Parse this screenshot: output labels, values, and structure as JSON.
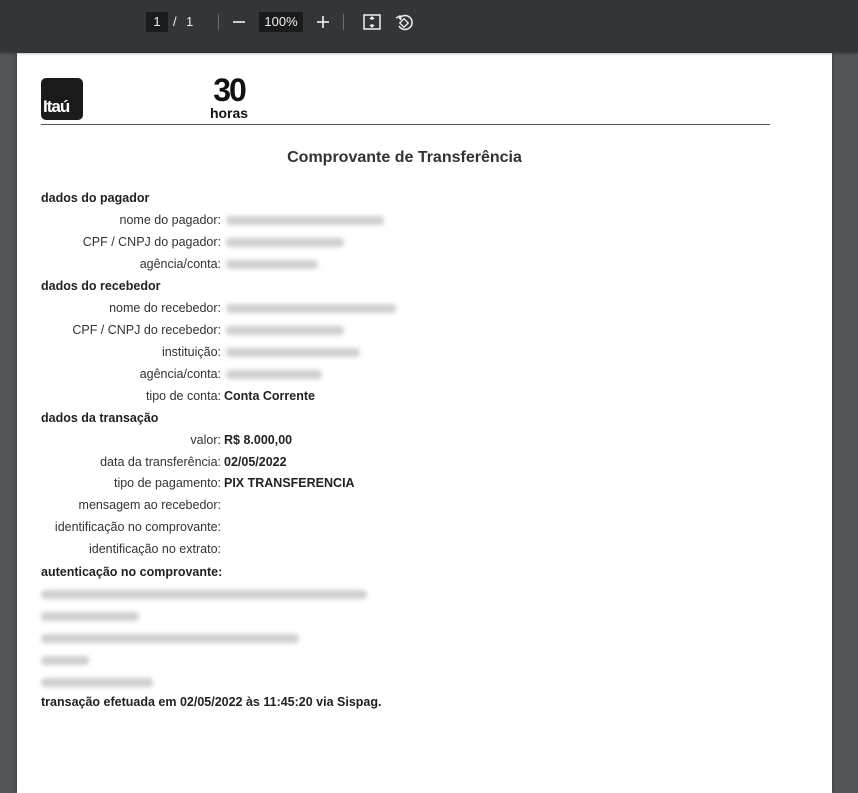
{
  "toolbar": {
    "current_page": "1",
    "page_separator": "/",
    "total_pages": "1",
    "zoom": "100%"
  },
  "header": {
    "bank_logo_text": "Itaú",
    "service_logo_number": "30",
    "service_logo_word": "horas"
  },
  "document": {
    "title": "Comprovante de Transferência",
    "payer": {
      "section": "dados do pagador",
      "name_label": "nome do pagador:",
      "cpf_label": "CPF / CNPJ do pagador:",
      "account_label": "agência/conta:"
    },
    "receiver": {
      "section": "dados do recebedor",
      "name_label": "nome do recebedor:",
      "cpf_label": "CPF / CNPJ do recebedor:",
      "institution_label": "instituição:",
      "account_label": "agência/conta:",
      "account_type_label": "tipo de conta:",
      "account_type_value": "Conta Corrente"
    },
    "transaction": {
      "section": "dados da transação",
      "value_label": "valor:",
      "value": "R$ 8.000,00",
      "date_label": "data da transferência:",
      "date": "02/05/2022",
      "payment_type_label": "tipo de pagamento:",
      "payment_type": "PIX TRANSFERENCIA",
      "message_label": "mensagem ao recebedor:",
      "receipt_id_label": "identificação no comprovante:",
      "statement_id_label": "identificação no extrato:"
    },
    "auth_label": "autenticação no comprovante:",
    "footer": "transação efetuada em 02/05/2022 às 11:45:20 via Sispag."
  }
}
